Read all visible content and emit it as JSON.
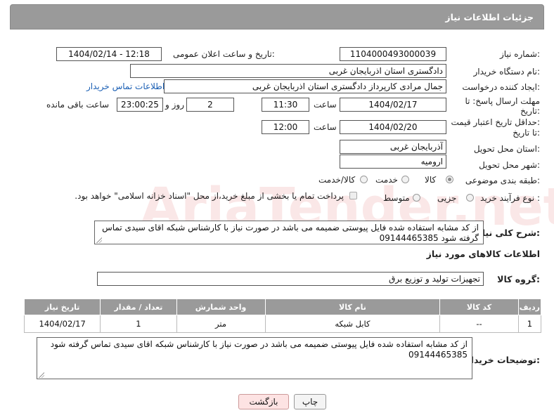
{
  "header": {
    "title": "جزئیات اطلاعات نیاز"
  },
  "watermark": {
    "text": "AriaTender.net"
  },
  "labels": {
    "need_number": "شماره نیاز:",
    "announce_datetime": "تاریخ و ساعت اعلان عمومی:",
    "buyer_org": "نام دستگاه خریدار:",
    "requester": "ایجاد کننده درخواست:",
    "contact_link": "اطلاعات تماس خریدار",
    "reply_deadline_1": "مهلت ارسال پاسخ: تا",
    "reply_deadline_2": "تاریخ:",
    "time": "ساعت",
    "day_and": "روز و",
    "remaining": "ساعت باقی مانده",
    "price_validity_1": "حداقل تاریخ اعتبار قیمت:",
    "price_validity_2": "تا تاریخ:",
    "delivery_province": "استان محل تحویل:",
    "delivery_city": "شهر محل تحویل:",
    "category": "طبقه بندی موضوعی:",
    "purchase_type": "نوع فرآیند خرید :",
    "overall_desc": "شرح کلی نیاز:",
    "goods_info": "اطلاعات کالاهای مورد نیاز",
    "goods_group": "گروه کالا:",
    "buyer_notes": "توضیحات خریدار:"
  },
  "fields": {
    "need_number": "1104000493000039",
    "announce_datetime": "1404/02/14 - 12:18",
    "buyer_org": "دادگستری استان اذربایجان غربی",
    "requester": "جمال مرادی کارپرداز دادگستری استان اذربایجان غربی",
    "reply_date": "1404/02/17",
    "reply_time": "11:30",
    "reply_days": "2",
    "remaining_time": "23:00:25",
    "price_date": "1404/02/20",
    "price_time": "12:00",
    "province": "آذربایجان غربی",
    "city": "ارومیه",
    "overall_desc": "از کد مشابه استفاده شده فایل پیوستی ضمیمه می باشد در صورت نیاز با کارشناس شبکه اقای سیدی تماس گرفته شود 09144465385",
    "goods_group": "تجهیزات تولید و توزیع برق",
    "buyer_notes": "از کد مشابه استفاده شده فایل پیوستی ضمیمه می باشد در صورت نیاز با کارشناس شبکه اقای سیدی تماس گرفته شود 09144465385"
  },
  "category_options": [
    {
      "label": "کالا",
      "checked": true
    },
    {
      "label": "خدمت",
      "checked": false
    },
    {
      "label": "کالا/خدمت",
      "checked": false
    }
  ],
  "purchase_options": [
    {
      "label": "جزیی",
      "checked": false
    },
    {
      "label": "متوسط",
      "checked": false
    }
  ],
  "payment_note": "پرداخت تمام یا بخشی از مبلغ خرید،از محل \"اسناد خزانه اسلامی\" خواهد بود.",
  "table": {
    "headers": [
      "ردیف",
      "کد کالا",
      "نام کالا",
      "واحد شمارش",
      "تعداد / مقدار",
      "تاریخ نیاز"
    ],
    "rows": [
      [
        "1",
        "--",
        "کابل شبکه",
        "متر",
        "1",
        "1404/02/17"
      ]
    ]
  },
  "buttons": {
    "print": "چاپ",
    "back": "بازگشت"
  }
}
